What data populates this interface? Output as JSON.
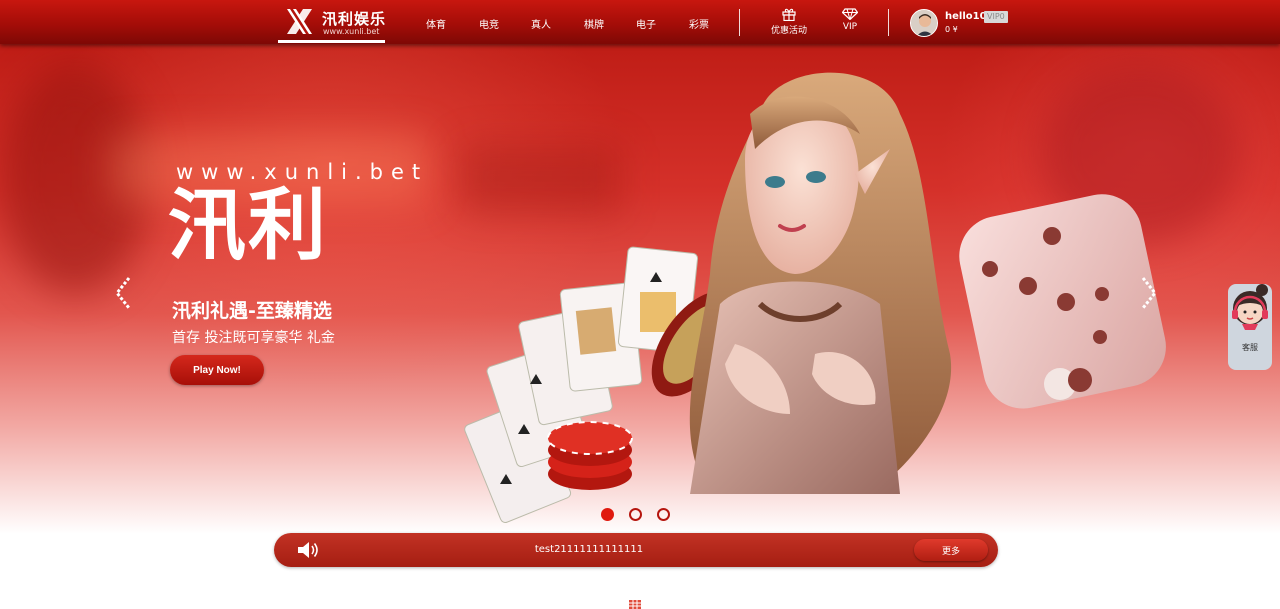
{
  "header": {
    "logo_name": "汛利娱乐",
    "logo_url": "www.xunli.bet",
    "nav": [
      "体育",
      "电竞",
      "真人",
      "棋牌",
      "电子",
      "彩票"
    ],
    "promo_label": "优惠活动",
    "vip_label": "VIP",
    "icons": {
      "promo": "gift-icon",
      "vip": "diamond-icon"
    },
    "user": {
      "name": "hello10",
      "vip_level": "VIP0",
      "balance": "0 ¥"
    }
  },
  "hero": {
    "url_text": "www.xunli.bet",
    "brand": "汛利",
    "headline": "汛利礼遇-至臻精选",
    "subtext": "首存 投注既可享豪华 礼金",
    "cta": "Play Now!",
    "slide_count": 3,
    "active_slide": 1
  },
  "service": {
    "label": "客服"
  },
  "notice": {
    "text": "test21111111111111",
    "more": "更多"
  },
  "colors": {
    "primary": "#b5150e",
    "header_top": "#c8170f",
    "header_bottom": "#7e0805",
    "notice": "#b02415"
  }
}
